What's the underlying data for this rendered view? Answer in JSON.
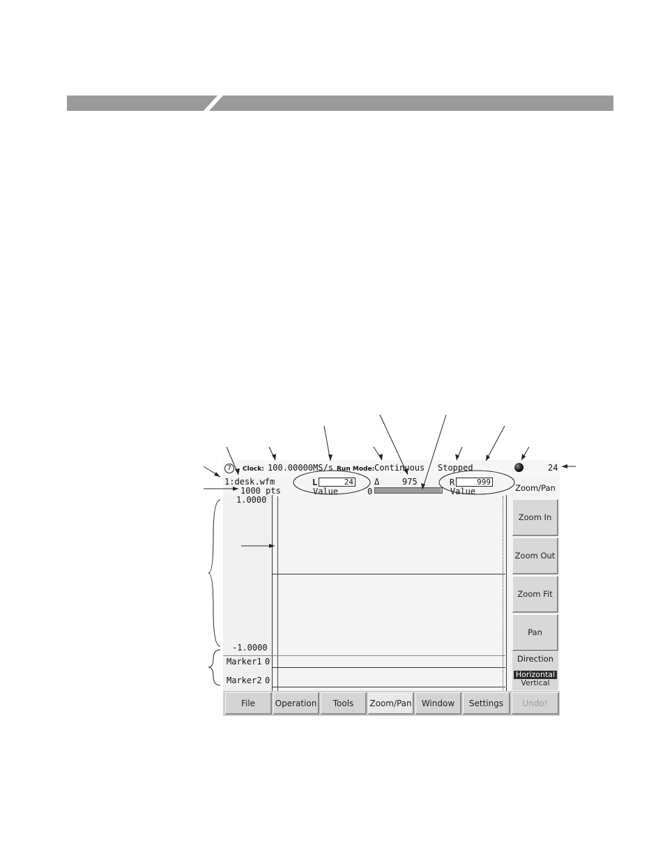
{
  "status": {
    "clock_label": "Clock:",
    "clock_value": "100.00000MS/s",
    "run_mode_label": "Run Mode:",
    "run_mode_value": "Continuous",
    "state": "Stopped",
    "number": "24"
  },
  "waveform": {
    "name": "1:desk.wfm",
    "points": "1000 pts",
    "left_cursor_label": "L",
    "left_cursor_value": "24",
    "left_value_label": "Value",
    "delta_symbol": "Δ",
    "delta_value": "975",
    "gauge_start": "0",
    "gauge_fraction": 0.975,
    "right_cursor_label": "R",
    "right_cursor_value": "999",
    "right_value_label": "Value"
  },
  "axis": {
    "ymax": "1.0000",
    "ymin": "-1.0000"
  },
  "markers": [
    {
      "label": "Marker1",
      "value": "0"
    },
    {
      "label": "Marker2",
      "value": "0"
    }
  ],
  "side_menu": {
    "title": "Zoom/Pan",
    "buttons": [
      "Zoom In",
      "Zoom Out",
      "Zoom Fit",
      "Pan"
    ],
    "direction_label": "Direction",
    "direction_options": [
      "Horizontal",
      "Vertical"
    ],
    "direction_selected": "Horizontal"
  },
  "bottom_menu": {
    "items": [
      "File",
      "Operation",
      "Tools",
      "Zoom/Pan",
      "Window",
      "Settings",
      "Undo!"
    ],
    "active": "Zoom/Pan",
    "disabled": "Undo!"
  },
  "colors": {
    "header_bar": "#9a9a9a",
    "highlight": "#2a2a2a",
    "gauge": "#b4b4b4"
  }
}
